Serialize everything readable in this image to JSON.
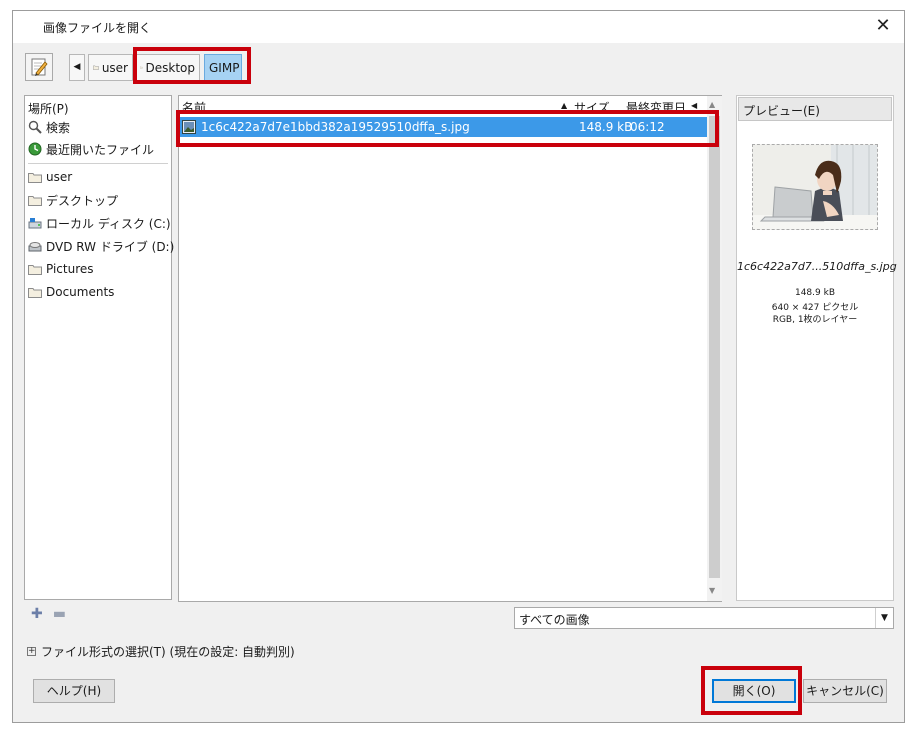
{
  "window": {
    "title": "画像ファイルを開く",
    "close_glyph": "✕"
  },
  "pathbar": {
    "crumbs": [
      {
        "label": "user"
      },
      {
        "label": "Desktop"
      },
      {
        "label": "GIMP"
      }
    ]
  },
  "places": {
    "header": "場所(P)",
    "items": [
      {
        "label": "検索",
        "icon": "search-icon"
      },
      {
        "label": "最近開いたファイル",
        "icon": "recent-icon"
      },
      {
        "label": "user",
        "icon": "folder-icon"
      },
      {
        "label": "デスクトップ",
        "icon": "folder-icon"
      },
      {
        "label": "ローカル ディスク (C:)",
        "icon": "drive-icon"
      },
      {
        "label": "DVD RW ドライブ (D:)",
        "icon": "dvd-icon"
      },
      {
        "label": "Pictures",
        "icon": "folder-icon"
      },
      {
        "label": "Documents",
        "icon": "folder-icon"
      }
    ],
    "add_glyph": "✚",
    "remove_glyph": "▬"
  },
  "filelist": {
    "columns": {
      "name": "名前",
      "size": "サイズ",
      "modified": "最終変更日"
    },
    "rows": [
      {
        "name": "1c6c422a7d7e1bbd382a19529510dffa_s.jpg",
        "size": "148.9 kB",
        "modified": "06:12"
      }
    ]
  },
  "preview": {
    "label": "プレビュー(E)",
    "filename": "1c6c422a7d7...510dffa_s.jpg",
    "filesize": "148.9 kB",
    "dimensions": "640 × 427 ピクセル",
    "layers": "RGB, 1枚のレイヤー"
  },
  "filter": {
    "selected": "すべての画像"
  },
  "filetype": {
    "label": "ファイル形式の選択(T) (現在の設定: 自動判別)"
  },
  "buttons": {
    "help": "ヘルプ(H)",
    "open": "開く(O)",
    "cancel": "キャンセル(C)"
  },
  "colors": {
    "selection": "#3c99e8",
    "highlight": "#c9000b",
    "default_button": "#0078d7"
  }
}
